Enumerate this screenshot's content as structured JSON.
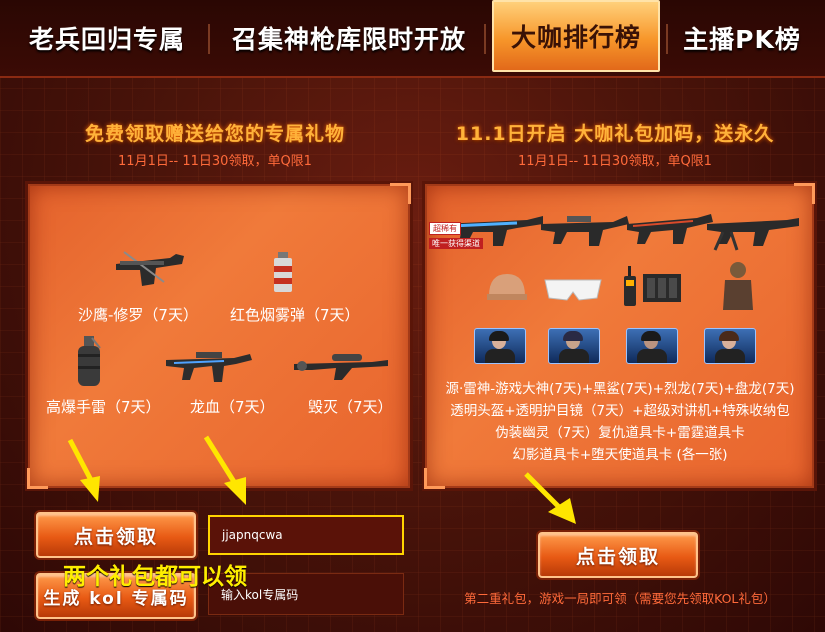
{
  "tabs": [
    {
      "label": "老兵回归专属"
    },
    {
      "label": "召集神枪库限时开放"
    },
    {
      "label": "大咖排行榜"
    },
    {
      "label": "主播PK榜"
    }
  ],
  "left_section": {
    "title": "免费领取赠送给您的专属礼物",
    "subtitle": "11月1日-- 11日30领取，单Q限1",
    "items": [
      {
        "label": "沙鹰-修罗（7天）",
        "icon": "pistol-icon"
      },
      {
        "label": "红色烟雾弹（7天）",
        "icon": "smoke-grenade-icon"
      },
      {
        "label": "高爆手雷（7天）",
        "icon": "grenade-icon"
      },
      {
        "label": "龙血（7天）",
        "icon": "rifle-icon"
      },
      {
        "label": "毁灭（7天）",
        "icon": "sniper-rifle-icon"
      }
    ],
    "claim_button": "点击领取",
    "generate_button": "生成 kol 专属码",
    "code_value": "jjapnqcwa",
    "code_input_placeholder": "输入kol专属码"
  },
  "right_section": {
    "title": "11.1日开启 大咖礼包加码，送永久",
    "subtitle": "11月1日-- 11日30领取，单Q限1",
    "badge_rare": "超稀有",
    "badge_only": "唯一获得渠道",
    "description_lines": [
      "源·雷神-游戏大神(7天)+黑鲨(7天)+烈龙(7天)+盘龙(7天)",
      "透明头盔+透明护目镜（7天）+超级对讲机+特殊收纳包",
      "伪装幽灵（7天）复仇道具卡+雷霆道具卡",
      "幻影道具卡+堕天使道具卡 (各一张)"
    ],
    "claim_button": "点击领取",
    "note": "第二重礼包，游戏一局即可领（需要您先领取KOL礼包）"
  },
  "overlay_text": "两个礼包都可以领",
  "colors": {
    "accent": "#ffb23a",
    "panel": "#ec6f33",
    "arrow": "#ffe600",
    "highlight_border": "#ffd400"
  }
}
